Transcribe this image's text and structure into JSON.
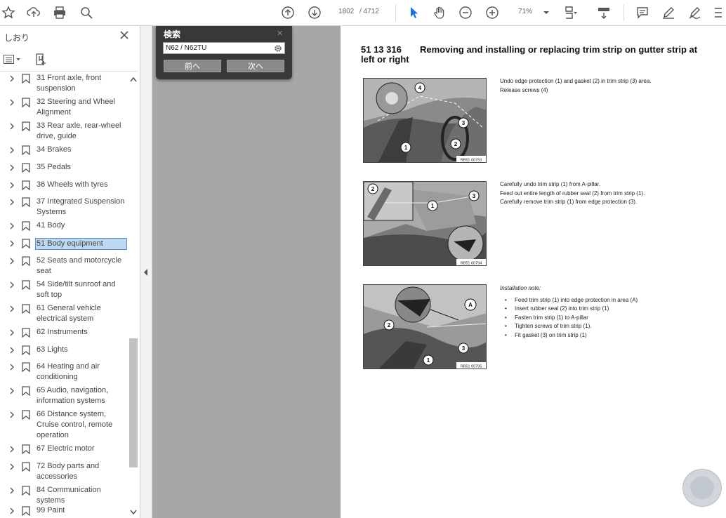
{
  "toolbar": {
    "page_current": "1802",
    "page_total": "/ 4712",
    "zoom": "71%"
  },
  "sidebar": {
    "title": "しおり",
    "items": [
      {
        "label": "31 Front axle, front suspension"
      },
      {
        "label": "32 Steering and Wheel Alignment"
      },
      {
        "label": "33 Rear axle, rear-wheel drive, guide"
      },
      {
        "label": "34 Brakes"
      },
      {
        "label": "35 Pedals"
      },
      {
        "label": "36 Wheels with tyres"
      },
      {
        "label": "37 Integrated Suspension Systems"
      },
      {
        "label": "41 Body"
      },
      {
        "label": "51 Body equipment"
      },
      {
        "label": "52 Seats and motorcycle seat"
      },
      {
        "label": "54 Side/tilt sunroof and soft top"
      },
      {
        "label": "61 General vehicle electrical system"
      },
      {
        "label": "62 Instruments"
      },
      {
        "label": "63 Lights"
      },
      {
        "label": "64 Heating and air conditioning"
      },
      {
        "label": "65 Audio, navigation, information systems"
      },
      {
        "label": "66 Distance system, Cruise control, remote operation"
      },
      {
        "label": "67 Electric motor"
      },
      {
        "label": "72 Body parts and accessories"
      },
      {
        "label": "84 Communication systems"
      },
      {
        "label": "99 Paint"
      }
    ]
  },
  "find": {
    "title": "検索",
    "query": "N62 / N62TU",
    "prev_label": "前へ",
    "next_label": "次へ"
  },
  "document": {
    "section_number": "51 13 316",
    "section_title": "Removing and installing or replacing trim strip on gutter strip at left or right",
    "figures": [
      {
        "code": "RB51 00793",
        "callouts": [
          "1",
          "2",
          "3",
          "4"
        ]
      },
      {
        "code": "RB51 00794",
        "callouts": [
          "1",
          "2",
          "3"
        ]
      },
      {
        "code": "RB51 00795",
        "callouts": [
          "1",
          "2",
          "3",
          "A"
        ]
      }
    ],
    "step1": {
      "lines": [
        "Undo edge protection (1) and gasket (2) in trim strip (3) area.",
        "Release screws (4)"
      ]
    },
    "step2": {
      "lines": [
        "Carefully undo trim strip (1) from A-pillar.",
        "Feed out entire length of rubber seal (2) from trim strip (1).",
        "Carefully remove trim strip (1) from edge protection (3)."
      ]
    },
    "step3": {
      "note": "Installation note:",
      "bullets": [
        "Feed trim strip (1) into edge protection in area (A)",
        "Insert rubber seal (2) into trim strip (1)",
        "Fasten trim strip (1) to A-pillar",
        "Tighten screws of trim strip (1).",
        "Fit gasket (3) on trim strip (1)"
      ]
    }
  },
  "colors": {
    "selection_bg": "#bcd8f2",
    "canvas_bg": "#a7a7a7",
    "find_bg": "#383838"
  }
}
